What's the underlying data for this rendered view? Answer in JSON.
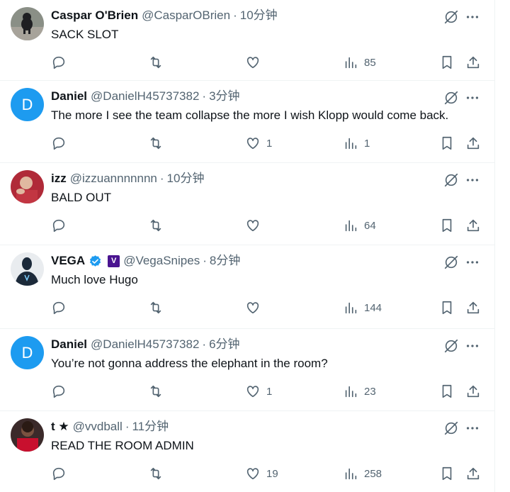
{
  "tweets": [
    {
      "name": "Caspar O'Brien",
      "handle": "@CasparOBrien",
      "time": "10分钟",
      "text": "SACK SLOT",
      "likes": "",
      "views": "85",
      "avatar_letter": ""
    },
    {
      "name": "Daniel",
      "handle": "@DanielH45737382",
      "time": "3分钟",
      "text": "The more I see the team collapse the more I wish Klopp would come back.",
      "likes": "1",
      "views": "1",
      "avatar_letter": "D"
    },
    {
      "name": "izz",
      "handle": "@izzuannnnnnn",
      "time": "10分钟",
      "text": "BALD OUT",
      "likes": "",
      "views": "64",
      "avatar_letter": ""
    },
    {
      "name": "VEGA",
      "handle": "@VegaSnipes",
      "time": "8分钟",
      "text": "Much love Hugo",
      "likes": "",
      "views": "144",
      "avatar_letter": ""
    },
    {
      "name": "Daniel",
      "handle": "@DanielH45737382",
      "time": "6分钟",
      "text": "You’re not gonna address the elephant in the room?",
      "likes": "1",
      "views": "23",
      "avatar_letter": "D"
    },
    {
      "name": "t ★",
      "handle": "@vvdball",
      "time": "11分钟",
      "text": "READ THE ROOM ADMIN",
      "likes": "19",
      "views": "258",
      "avatar_letter": ""
    }
  ],
  "separator": "·",
  "affiliate_badge": "V",
  "colors": {
    "accent": "#1d9bf0",
    "secondary_text": "#536471",
    "affiliate": "#4a1490"
  },
  "icons": [
    "reply-icon",
    "retweet-icon",
    "like-icon",
    "views-icon",
    "bookmark-icon",
    "share-icon",
    "grok-icon",
    "more-icon",
    "verified-icon"
  ]
}
